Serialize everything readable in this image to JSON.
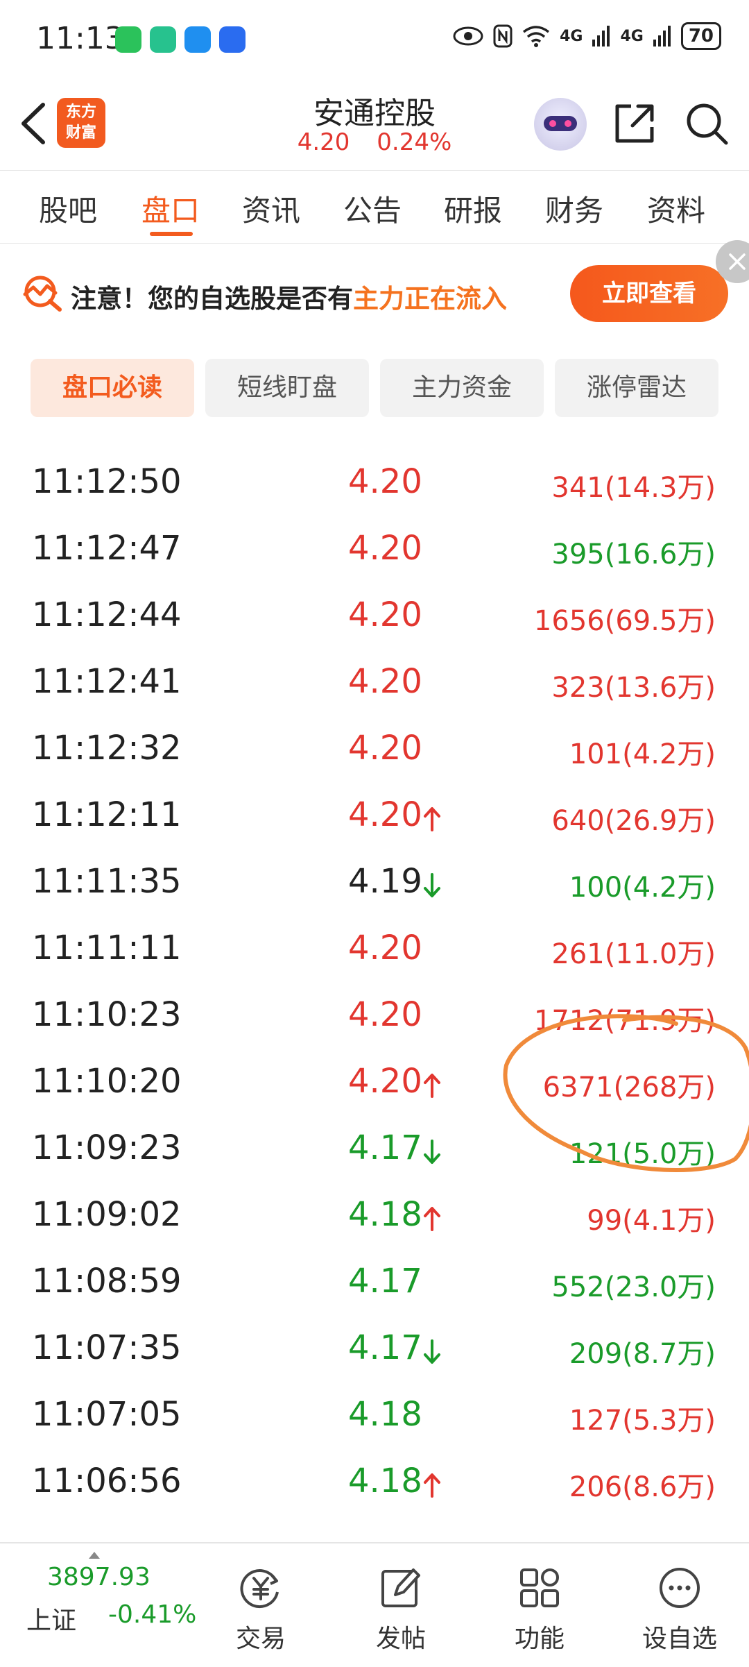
{
  "status_bar": {
    "time": "11:13",
    "battery": "70",
    "network1": "4G",
    "network2": "4G"
  },
  "header": {
    "logo_line1": "东方",
    "logo_line2": "财富",
    "stock_name": "安通控股",
    "price": "4.20",
    "change_pct": "0.24%"
  },
  "tabs": [
    {
      "label": "股吧"
    },
    {
      "label": "盘口",
      "active": true
    },
    {
      "label": "资讯"
    },
    {
      "label": "公告"
    },
    {
      "label": "研报"
    },
    {
      "label": "财务"
    },
    {
      "label": "资料"
    }
  ],
  "banner": {
    "text_prefix": "注意！您的自选股是否有",
    "text_highlight": "主力正在流入",
    "button": "立即查看"
  },
  "segments": [
    {
      "label": "盘口必读",
      "active": true
    },
    {
      "label": "短线盯盘"
    },
    {
      "label": "主力资金"
    },
    {
      "label": "涨停雷达"
    }
  ],
  "trades": [
    {
      "time": "11:12:50",
      "price": "4.20",
      "price_color": "red",
      "arrow": "",
      "volume": "341(14.3万)",
      "vol_color": "red"
    },
    {
      "time": "11:12:47",
      "price": "4.20",
      "price_color": "red",
      "arrow": "",
      "volume": "395(16.6万)",
      "vol_color": "green"
    },
    {
      "time": "11:12:44",
      "price": "4.20",
      "price_color": "red",
      "arrow": "",
      "volume": "1656(69.5万)",
      "vol_color": "red"
    },
    {
      "time": "11:12:41",
      "price": "4.20",
      "price_color": "red",
      "arrow": "",
      "volume": "323(13.6万)",
      "vol_color": "red"
    },
    {
      "time": "11:12:32",
      "price": "4.20",
      "price_color": "red",
      "arrow": "",
      "volume": "101(4.2万)",
      "vol_color": "red"
    },
    {
      "time": "11:12:11",
      "price": "4.20",
      "price_color": "red",
      "arrow": "up",
      "volume": "640(26.9万)",
      "vol_color": "red"
    },
    {
      "time": "11:11:35",
      "price": "4.19",
      "price_color": "dark",
      "arrow": "down",
      "volume": "100(4.2万)",
      "vol_color": "green"
    },
    {
      "time": "11:11:11",
      "price": "4.20",
      "price_color": "red",
      "arrow": "",
      "volume": "261(11.0万)",
      "vol_color": "red"
    },
    {
      "time": "11:10:23",
      "price": "4.20",
      "price_color": "red",
      "arrow": "",
      "volume": "1712(71.9万)",
      "vol_color": "red"
    },
    {
      "time": "11:10:20",
      "price": "4.20",
      "price_color": "red",
      "arrow": "up",
      "volume": "6371(268万)",
      "vol_color": "red"
    },
    {
      "time": "11:09:23",
      "price": "4.17",
      "price_color": "green",
      "arrow": "down",
      "volume": "121(5.0万)",
      "vol_color": "green"
    },
    {
      "time": "11:09:02",
      "price": "4.18",
      "price_color": "green",
      "arrow": "up",
      "volume": "99(4.1万)",
      "vol_color": "red"
    },
    {
      "time": "11:08:59",
      "price": "4.17",
      "price_color": "green",
      "arrow": "",
      "volume": "552(23.0万)",
      "vol_color": "green"
    },
    {
      "time": "11:07:35",
      "price": "4.17",
      "price_color": "green",
      "arrow": "down",
      "volume": "209(8.7万)",
      "vol_color": "green"
    },
    {
      "time": "11:07:05",
      "price": "4.18",
      "price_color": "green",
      "arrow": "",
      "volume": "127(5.3万)",
      "vol_color": "red"
    },
    {
      "time": "11:06:56",
      "price": "4.18",
      "price_color": "green",
      "arrow": "up",
      "volume": "206(8.6万)",
      "vol_color": "red"
    }
  ],
  "bottom_bar": {
    "index_value": "3897.93",
    "index_name": "上证",
    "index_change": "-0.41%",
    "nav": [
      {
        "label": "交易",
        "icon": "yuan-exchange-icon"
      },
      {
        "label": "发帖",
        "icon": "edit-post-icon"
      },
      {
        "label": "功能",
        "icon": "grid-function-icon"
      },
      {
        "label": "设自选",
        "icon": "more-dots-icon"
      }
    ]
  },
  "colors": {
    "accent": "#f35b1e",
    "up_red": "#e2362f",
    "down_green": "#1a9b2a",
    "annotation": "#f08a3a"
  }
}
